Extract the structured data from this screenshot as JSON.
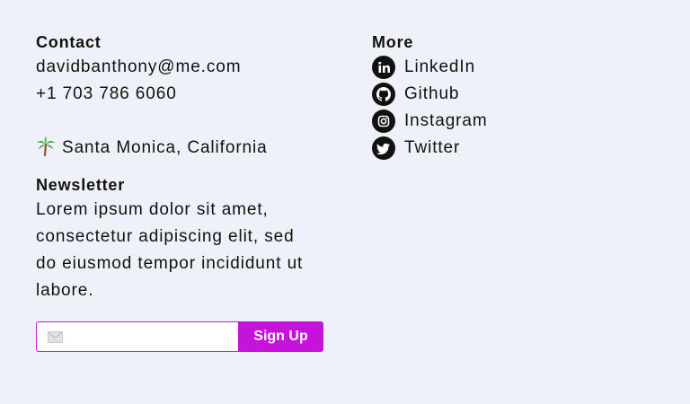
{
  "contact": {
    "heading": "Contact",
    "email": "davidbanthony@me.com",
    "phone": "+1 703 786 6060",
    "location": "Santa Monica, California",
    "location_icon": "palm-tree-icon"
  },
  "newsletter": {
    "heading": "Newsletter",
    "text": "Lorem ipsum dolor sit amet, consectetur adipiscing elit, sed do eiusmod tempor incididunt ut labore.",
    "email_value": "",
    "email_icon": "mail-icon",
    "button_label": "Sign Up"
  },
  "more": {
    "heading": "More",
    "links": [
      {
        "label": "LinkedIn",
        "icon": "linkedin-icon"
      },
      {
        "label": "Github",
        "icon": "github-icon"
      },
      {
        "label": "Instagram",
        "icon": "instagram-icon"
      },
      {
        "label": "Twitter",
        "icon": "twitter-icon"
      }
    ]
  },
  "colors": {
    "background": "#eef1f7",
    "accent": "#c613dc",
    "text": "#111111"
  }
}
